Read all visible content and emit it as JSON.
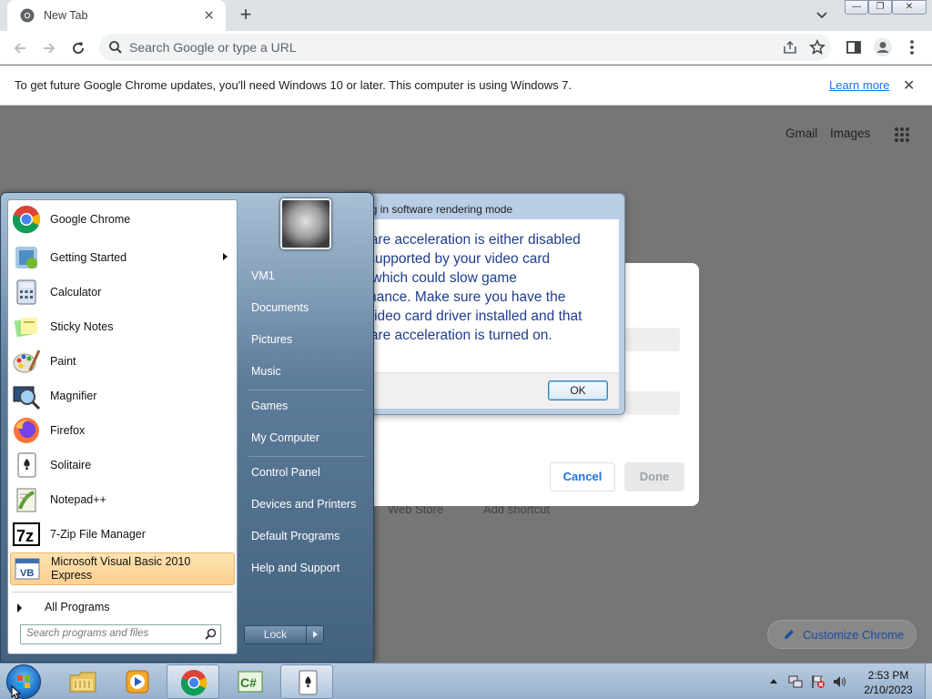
{
  "browser": {
    "tab_title": "New Tab",
    "tab_close": "✕",
    "new_tab": "+",
    "omnibox_placeholder": "Search Google or type a URL"
  },
  "infobar": {
    "message": "To get future Google Chrome updates, you'll need Windows 10 or later. This computer is using Windows 7.",
    "link": "Learn more",
    "close": "✕"
  },
  "ntp": {
    "gmail": "Gmail",
    "images": "Images",
    "shortcuts": [
      "Web Store",
      "Add shortcut"
    ],
    "customize": "Customize Chrome"
  },
  "edit_dialog": {
    "cancel": "Cancel",
    "done": "Done"
  },
  "warning_dialog": {
    "title": "nning in software rendering mode",
    "body": "dware acceleration is either disabled\not supported by your video card\ner, which could slow game\normance. Make sure you have the\nst video card driver installed and that\ndware acceleration is turned on.",
    "ok": "OK"
  },
  "start_menu": {
    "programs": [
      {
        "label": "Google Chrome",
        "icon": "chrome-icon"
      },
      {
        "label": "Getting Started",
        "icon": "getting-started-icon",
        "submenu": true
      },
      {
        "label": "Calculator",
        "icon": "calculator-icon"
      },
      {
        "label": "Sticky Notes",
        "icon": "sticky-notes-icon"
      },
      {
        "label": "Paint",
        "icon": "paint-icon"
      },
      {
        "label": "Magnifier",
        "icon": "magnifier-icon"
      },
      {
        "label": "Firefox",
        "icon": "firefox-icon"
      },
      {
        "label": "Solitaire",
        "icon": "solitaire-icon"
      },
      {
        "label": "Notepad++",
        "icon": "notepadpp-icon"
      },
      {
        "label": "7-Zip File Manager",
        "icon": "7zip-icon"
      },
      {
        "label": "Microsoft Visual Basic 2010 Express",
        "icon": "vb-icon",
        "highlighted": true
      }
    ],
    "all_programs": "All Programs",
    "search_placeholder": "Search programs and files",
    "right_links": [
      "VM1",
      "Documents",
      "Pictures",
      "Music",
      "Games",
      "My Computer",
      "Control Panel",
      "Devices and Printers",
      "Default Programs",
      "Help and Support"
    ],
    "lock": "Lock"
  },
  "taskbar": {
    "time": "2:53 PM",
    "date": "2/10/2023",
    "buttons": [
      "explorer-icon",
      "media-player-icon",
      "chrome-icon",
      "csharp-icon",
      "solitaire-icon"
    ]
  },
  "colors": {
    "chrome_blue": "#1a73e8",
    "warn_text": "#1e3d8f",
    "highlight": "#fbd092"
  }
}
